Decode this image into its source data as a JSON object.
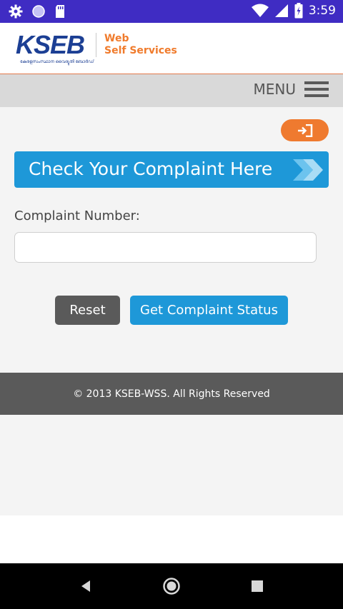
{
  "status_bar": {
    "time": "3:59",
    "icons": [
      "gear-icon",
      "circle-icon",
      "sd-card-icon",
      "wifi-icon",
      "signal-icon",
      "battery-icon"
    ]
  },
  "header": {
    "logo_text": "KSEB",
    "logo_subtext": "കേരളസംസ്ഥാന വൈദ്യുതി ബോർഡ്",
    "tagline_line1": "Web",
    "tagline_line2": "Self Services"
  },
  "menubar": {
    "menu_label": "MENU",
    "icon": "hamburger-icon"
  },
  "main": {
    "login_icon": "sign-in-icon",
    "banner_title": "Check Your Complaint Here",
    "banner_icon": "double-chevron-right-icon",
    "complaint_label": "Complaint Number:",
    "complaint_value": "",
    "complaint_placeholder": "",
    "reset_label": "Reset",
    "status_label": "Get Complaint Status"
  },
  "footer": {
    "copyright": "© 2013 KSEB-WSS. All Rights Reserved"
  },
  "navbar": {
    "icons": [
      "back-icon",
      "home-icon",
      "recents-icon"
    ]
  },
  "colors": {
    "status_bar": "#3f2cc3",
    "brand_blue": "#1c3f94",
    "accent_orange": "#ef7a2f",
    "primary_blue": "#1e98d8",
    "dark_gray": "#5a5a5a"
  }
}
